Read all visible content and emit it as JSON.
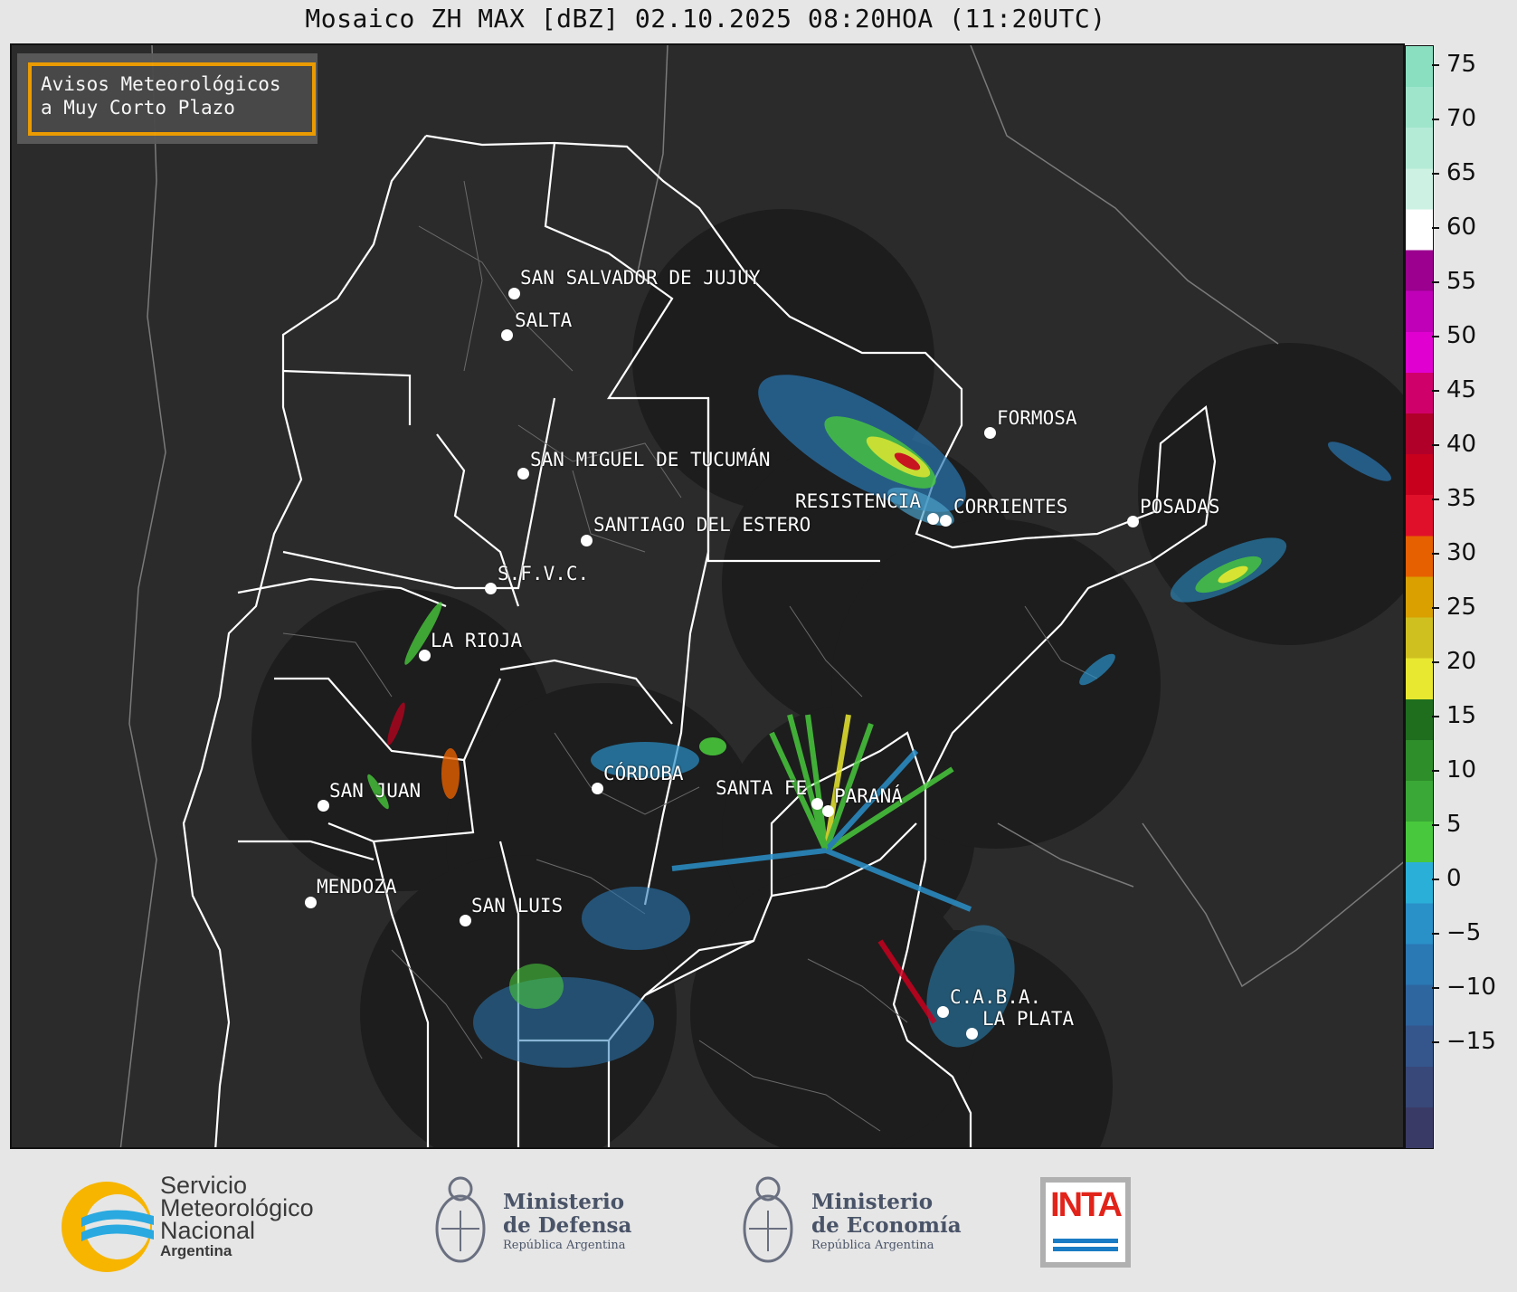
{
  "title": "Mosaico ZH MAX [dBZ] 02.10.2025 08:20HOA (11:20UTC)",
  "avisos": {
    "line1": "Avisos Meteorológicos",
    "line2": "a Muy Corto Plazo"
  },
  "cities": [
    {
      "name": "SAN SALVADOR DE JUJUY"
    },
    {
      "name": "SALTA"
    },
    {
      "name": "SAN MIGUEL DE TUCUMÁN"
    },
    {
      "name": "SANTIAGO DEL ESTERO"
    },
    {
      "name": "FORMOSA"
    },
    {
      "name": "RESISTENCIA"
    },
    {
      "name": "CORRIENTES"
    },
    {
      "name": "POSADAS"
    },
    {
      "name": "S.F.V.C."
    },
    {
      "name": "LA RIOJA"
    },
    {
      "name": "SAN JUAN"
    },
    {
      "name": "CÓRDOBA"
    },
    {
      "name": "SANTA FE"
    },
    {
      "name": "PARANÁ"
    },
    {
      "name": "MENDOZA"
    },
    {
      "name": "SAN LUIS"
    },
    {
      "name": "C.A.B.A."
    },
    {
      "name": "LA PLATA"
    }
  ],
  "colorbar": {
    "unit": "dBZ",
    "ticks": [
      "75",
      "70",
      "65",
      "60",
      "55",
      "50",
      "45",
      "40",
      "35",
      "30",
      "25",
      "20",
      "15",
      "10",
      "5",
      "0",
      "−5",
      "−10",
      "−15"
    ],
    "colors_top_to_bottom": [
      "#8adfc0",
      "#9fe5cc",
      "#b4ebd7",
      "#cdf2e3",
      "#ffffff",
      "#9b008f",
      "#c000b8",
      "#e000d0",
      "#d0006a",
      "#b0002a",
      "#c8001e",
      "#e0102a",
      "#e66000",
      "#d9a000",
      "#cfc020",
      "#e8e830",
      "#1e6e1e",
      "#2e8e2a",
      "#3aa836",
      "#48c83c",
      "#2ab0d8",
      "#2a90c8",
      "#2a78b4",
      "#2e66a0",
      "#34568c",
      "#384878",
      "#3a3a66"
    ]
  },
  "footer": {
    "smn": {
      "line1": "Servicio",
      "line2": "Meteorológico",
      "line3": "Nacional",
      "line4": "Argentina"
    },
    "defensa": {
      "line1": "Ministerio",
      "line2": "de Defensa",
      "line3": "República Argentina"
    },
    "economia": {
      "line1": "Ministerio",
      "line2": "de Economía",
      "line3": "República Argentina"
    },
    "inta": "INTA"
  }
}
